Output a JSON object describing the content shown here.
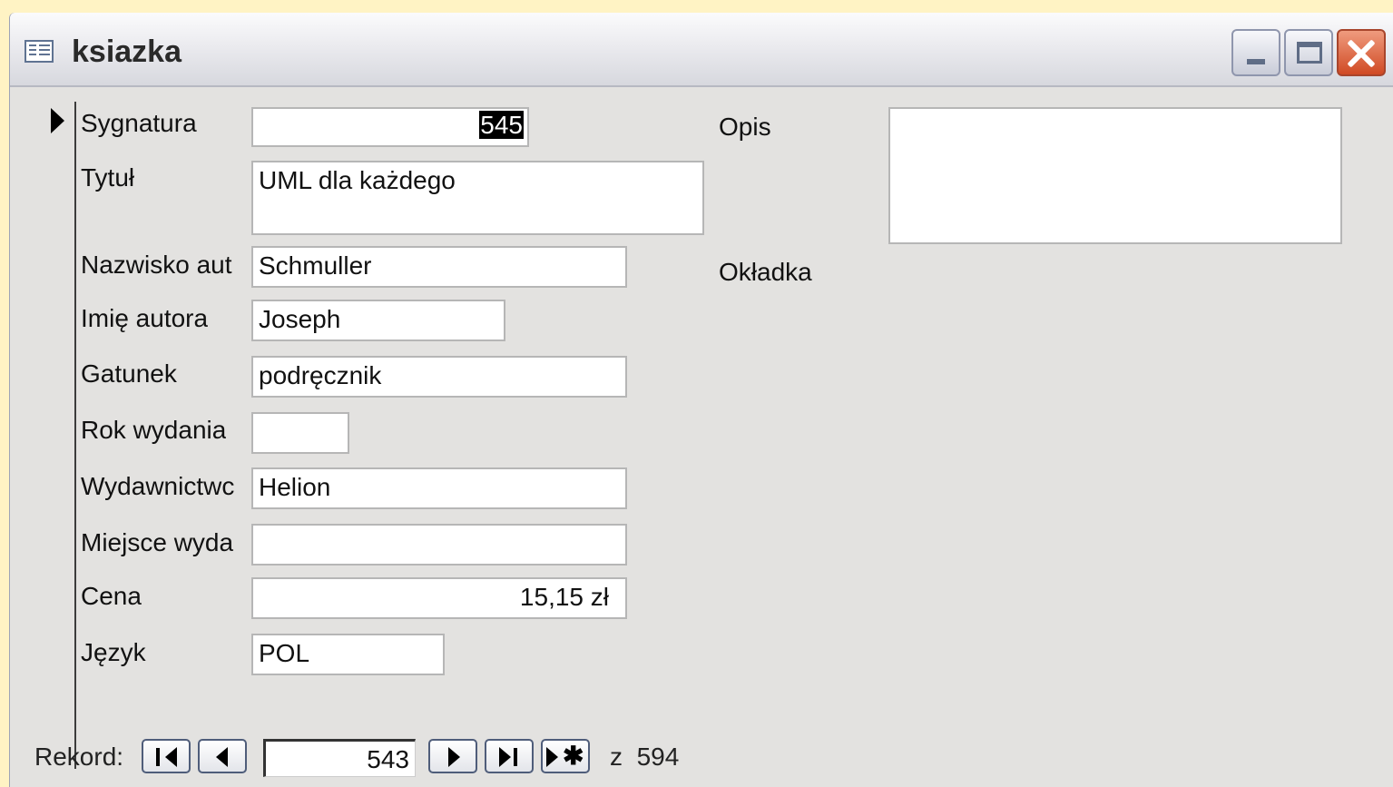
{
  "window": {
    "title": "ksiazka"
  },
  "fields": {
    "sygnatura": {
      "label": "Sygnatura",
      "value": "545"
    },
    "tytul": {
      "label": "Tytuł",
      "value": "UML dla każdego"
    },
    "nazwisko": {
      "label": "Nazwisko aut",
      "value": "Schmuller"
    },
    "imie": {
      "label": "Imię autora",
      "value": "Joseph"
    },
    "gatunek": {
      "label": "Gatunek",
      "value": "podręcznik"
    },
    "rok": {
      "label": "Rok wydania",
      "value": ""
    },
    "wydawnictwo": {
      "label": "Wydawnictwc",
      "value": "Helion"
    },
    "miejsce": {
      "label": "Miejsce wyda",
      "value": ""
    },
    "cena": {
      "label": "Cena",
      "value": "15,15 zł"
    },
    "jezyk": {
      "label": "Język",
      "value": "POL"
    },
    "opis": {
      "label": "Opis",
      "value": ""
    },
    "okladka": {
      "label": "Okładka"
    }
  },
  "navigation": {
    "label": "Rekord:",
    "current": "543",
    "of_label": "z",
    "total": "594"
  }
}
